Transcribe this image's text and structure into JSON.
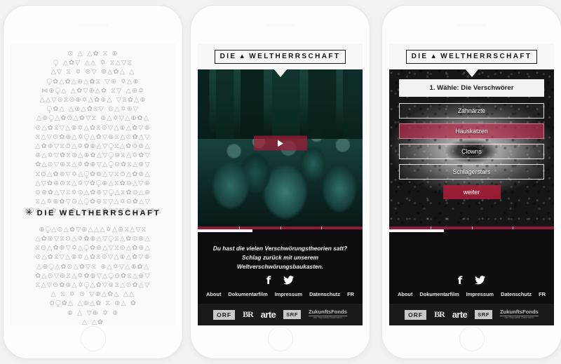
{
  "site": {
    "brand_first": "DIE",
    "brand_sep": "▲",
    "brand_second": "WELTHERRSCHAFT",
    "accent_color": "#a81e3a",
    "background_color": "#0d0d0f"
  },
  "screen_one": {
    "title_star": "✳",
    "title": "DIE WELTHERRSCHAFT",
    "symbol_rows": [
      "⊙    △  △✿  ⧖       ⊕",
      " ⧬    △✿▽  △△   ✡   ⧖△▽⧖",
      "△▽ ⧖  ✡   ⊙▽  ⊕△✿△    △",
      "  ⧬✿△✿△⊕△✿⧖  ▽⊕  ✡△⊕",
      "⋈⊕⧬△   △✿▽⊕△✿ ⧖▽ △⊕✡",
      "△△▽⊙⧖⊙⊕✡△✿⊕△ ▽⧖✿△⊕",
      "  ⧬✿△   △⊕△✿⧖▽ ⊙△✡⊕▽",
      "△⊕⧬△✿⊙△✿▽⧖ ⊕△✡▽△⊕✿△",
      "⊙△✿⧖▽△⊕✡△✿⧖⊙▽△⊕△✿▽⊕",
      "⧖△▽⊙✿⊕△✡⧬△✿▽⊕⧖△⊙✿△▽",
      "△✿⊕▽⧖⊙△✡✿⊕△▽⧬⧖△✿⊙⊕△",
      "⊕△✡▽✿⧖⊙△⊕✿△▽⧬⊕⧖△✡✿▽",
      "✿△⊙▽⊕⧖△✡✿⊕▽△⧬⊙✿⧖△⊕▽",
      "⧖⊙△✿⊕▽✡△⧬✿⊕△▽⧖⊙△✿⊕△",
      "△▽✿⊕⊙⧖△✡▽✿⧬⊕△⧖✿⊙△▽⊕",
      "⊙⊕✿△▽⧖✡⊙△✿⊕▽⧬△⧖✿⊙△⊕",
      "⧖△✡⊕✿▽⊙△⧬✿⊕⧖▽△✡⊙✿△▽",
      "XO⊙ ⧬✿ △ ✿ △⊕△ ✿⧖⧖▽⊕△✡△⊕△",
      "",
      "⊕⧬△⊙△✿▽⊕△△△✡△⊕⧖△▽⧖",
      "△✿⊕▽⧖⊙△✡✿⊕△▽⧬⧖△✿⊙⊕△",
      "⧖⊙△✿⊕▽✡△⧬✿⊕△▽⧖⊙△✿⊕△",
      "⊙△✿⧖▽△⊕✡△✿⧖⊙▽△⊕△✿▽⊕",
      "△⊕⧬△✿⊙△✿▽⧖ ⊕△✡▽△⊕✿△",
      "✿△⊙▽⊕⧖△✡✿⊕▽△⧬⊙✿⧖△⊕▽",
      "⧖△▽⊙✿⊕△✡⧬△✿▽⊕⧖△⊙✿△▽",
      "△ ⧖ ✡  ⊙  ▽⊕△✿△  △△",
      "⊙⧬✿△  △⊕△✿  ⧖  ⊕△    ✿",
      "⊕     △   ▽⊕      ✡  ⊕",
      "        △        △✿"
    ]
  },
  "screen_two": {
    "play_label": "play",
    "tagline_line1": "Du hast die vielen Verschwörungstheorien satt?",
    "tagline_line2": "Schlag zurück mit unserem Weltverschwörungsbaukasten."
  },
  "screen_three": {
    "question": "1. Wähle: Die Verschwörer",
    "options": [
      {
        "label": "Zahnärzte",
        "selected": false
      },
      {
        "label": "Hauskatzen",
        "selected": true
      },
      {
        "label": "Clowns",
        "selected": false
      },
      {
        "label": "Schlagerstars",
        "selected": false
      }
    ],
    "next_label": "weiter"
  },
  "progress": {
    "percent": 33,
    "ticks": [
      25,
      50,
      75
    ]
  },
  "footer": {
    "social": [
      {
        "name": "facebook",
        "glyph": "f"
      },
      {
        "name": "twitter",
        "glyph": "🐦"
      }
    ],
    "nav": [
      "About",
      "Dokumentarfilm",
      "Impressum",
      "Datenschutz",
      "FR"
    ],
    "sponsors": [
      {
        "name": "ORF",
        "label": "ORF"
      },
      {
        "name": "BR",
        "label": "BR"
      },
      {
        "name": "arte",
        "label": "arte"
      },
      {
        "name": "SRF",
        "label": "SRF"
      },
      {
        "name": "ZukunftsFonds",
        "label": "ZukunftsFonds",
        "sub": "der Republik Österreich"
      }
    ]
  }
}
